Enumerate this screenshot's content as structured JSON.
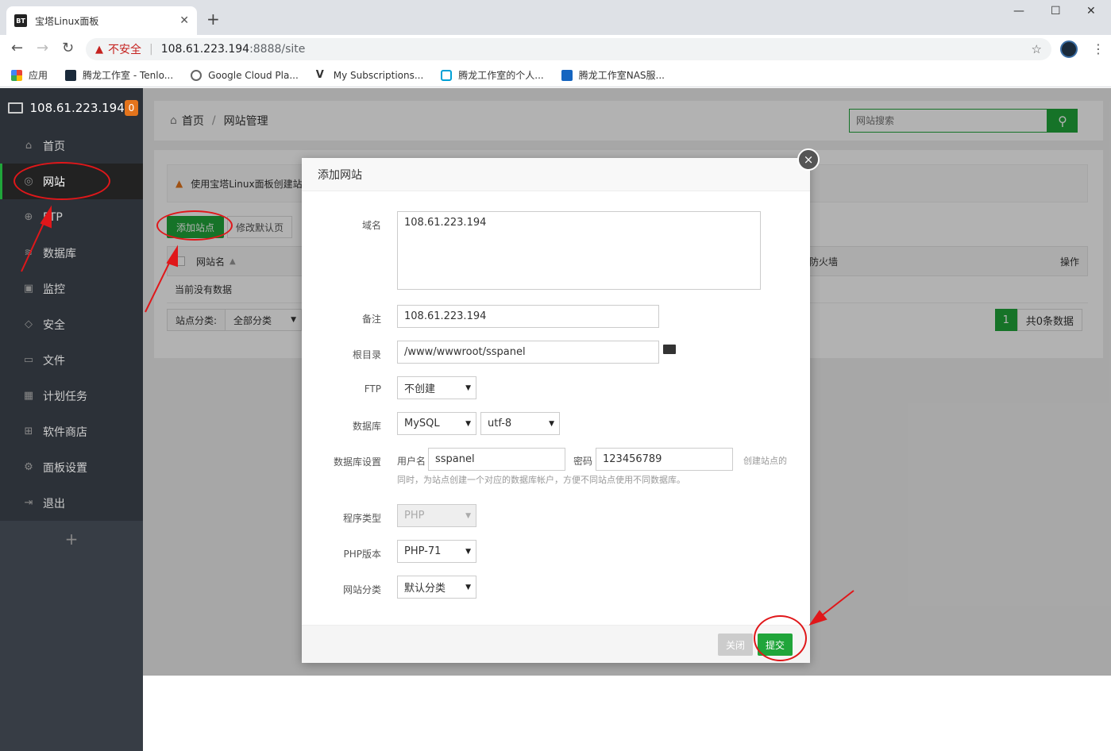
{
  "browser": {
    "tab_title": "宝塔Linux面板",
    "tab_favicon": "BT",
    "url_insecure_label": "不安全",
    "url_host": "108.61.223.194",
    "url_rest": ":8888/site",
    "bookmarks": [
      {
        "label": "应用",
        "icon": "apps-grid-icon"
      },
      {
        "label": "腾龙工作室 - Tenlo...",
        "icon": "tenlong-icon"
      },
      {
        "label": "Google Cloud Pla...",
        "icon": "gcp-icon"
      },
      {
        "label": "My Subscriptions...",
        "icon": "v-icon"
      },
      {
        "label": "腾龙工作室的个人...",
        "icon": "bilibili-icon"
      },
      {
        "label": "腾龙工作室NAS服...",
        "icon": "dsm-icon"
      }
    ]
  },
  "sidebar": {
    "server_ip": "108.61.223.194",
    "badge": "0",
    "items": [
      {
        "label": "首页",
        "icon": "home-icon"
      },
      {
        "label": "网站",
        "icon": "globe-icon"
      },
      {
        "label": "FTP",
        "icon": "ftp-icon"
      },
      {
        "label": "数据库",
        "icon": "database-icon"
      },
      {
        "label": "监控",
        "icon": "monitor-icon"
      },
      {
        "label": "安全",
        "icon": "shield-icon"
      },
      {
        "label": "文件",
        "icon": "folder-icon"
      },
      {
        "label": "计划任务",
        "icon": "calendar-icon"
      },
      {
        "label": "软件商店",
        "icon": "apps-icon"
      },
      {
        "label": "面板设置",
        "icon": "gear-icon"
      },
      {
        "label": "退出",
        "icon": "logout-icon"
      }
    ],
    "add_label": "+"
  },
  "header": {
    "crumb_home": "首页",
    "crumb_current": "网站管理",
    "search_placeholder": "网站搜索"
  },
  "main": {
    "alert_text": "使用宝塔Linux面板创建站",
    "add_site_button": "添加站点",
    "default_page_button": "修改默认页",
    "col_name": "网站名",
    "col_firewall": "防火墙",
    "col_ops": "操作",
    "empty_text": "当前没有数据",
    "filter_label": "站点分类:",
    "filter_value": "全部分类",
    "page_current": "1",
    "total_text": "共0条数据"
  },
  "modal": {
    "title": "添加网站",
    "close_icon": "×",
    "domain_label": "域名",
    "domain_value": "108.61.223.194",
    "remark_label": "备注",
    "remark_value": "108.61.223.194",
    "root_label": "根目录",
    "root_value": "/www/wwwroot/sspanel",
    "ftp_label": "FTP",
    "ftp_value": "不创建",
    "db_label": "数据库",
    "db_type": "MySQL",
    "db_charset": "utf-8",
    "dbset_label": "数据库设置",
    "db_user_label": "用户名",
    "db_user_value": "sspanel",
    "db_pass_label": "密码",
    "db_pass_value": "123456789",
    "db_note_1": "创建站点的",
    "db_note_2": "同时，为站点创建一个对应的数据库帐户，方便不同站点使用不同数据库。",
    "prog_label": "程序类型",
    "prog_value": "PHP",
    "php_label": "PHP版本",
    "php_value": "PHP-71",
    "cat_label": "网站分类",
    "cat_value": "默认分类",
    "cancel_button": "关闭",
    "submit_button": "提交"
  },
  "colors": {
    "accent": "#20a53a",
    "sidebar_bg": "#2c3138",
    "annotation_red": "#e0171a"
  }
}
